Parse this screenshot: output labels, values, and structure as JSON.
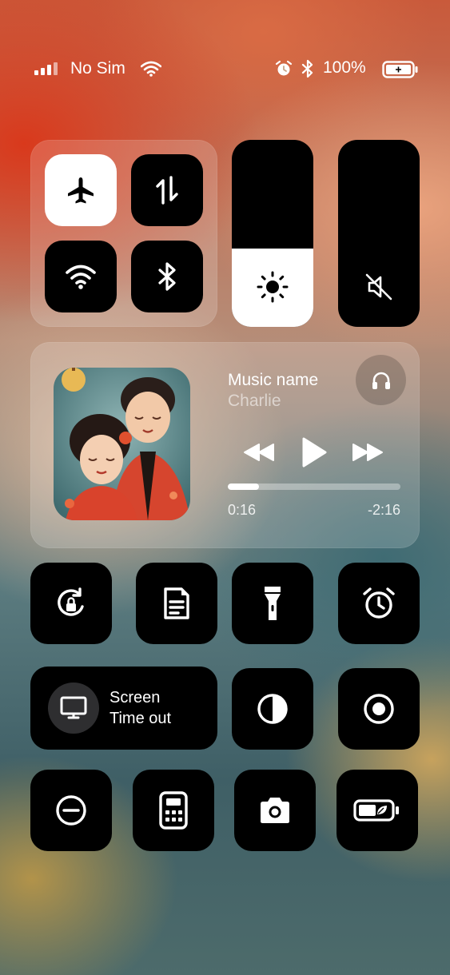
{
  "status_bar": {
    "carrier": "No Sim",
    "battery_percent": "100%",
    "icons": [
      "signal-icon",
      "wifi-icon",
      "alarm-icon",
      "bluetooth-icon",
      "battery-icon"
    ]
  },
  "connectivity": {
    "airplane_mode": true,
    "cellular_data": false,
    "wifi": false,
    "bluetooth": false
  },
  "sliders": {
    "brightness_level": 0.42,
    "volume_level": 0.0,
    "volume_muted": true
  },
  "now_playing": {
    "title": "Music name",
    "artist": "Charlie",
    "elapsed": "0:16",
    "remaining": "-2:16",
    "progress": 0.18
  },
  "controls": {
    "screen_timeout_line1": "Screen",
    "screen_timeout_line2": "Time out"
  },
  "colors": {
    "tile": "#000000",
    "active_tile": "#ffffff",
    "glass": "rgba(255,255,255,0.18)"
  }
}
